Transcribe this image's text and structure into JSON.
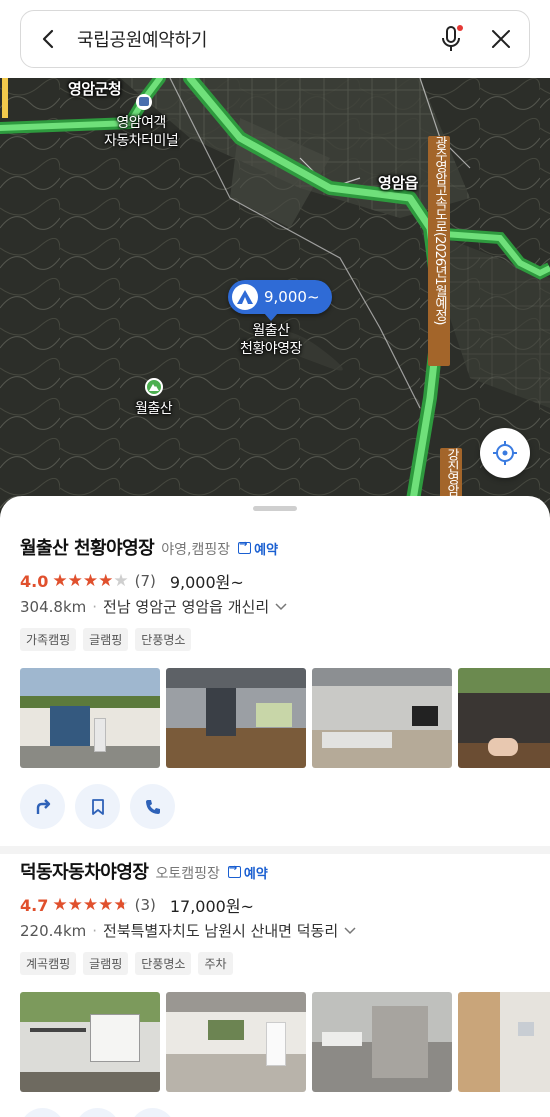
{
  "search": {
    "query": "국립공원예약하기"
  },
  "map": {
    "labels": {
      "county_office": "영암군청",
      "terminal": "영암여객\n자동차터미널",
      "town": "영암읍",
      "mountain": "월출산",
      "campsite": "월출산\n천황야영장",
      "highway": "광주영암고속도로(2026년1월예정)",
      "road2": "강진영암"
    },
    "pin_price": "9,000~"
  },
  "results": [
    {
      "name": "월출산 천황야영장",
      "category": "야영,캠핑장",
      "reserve_label": "예약",
      "rating": "4.0",
      "stars_filled": 4,
      "review_count": "(7)",
      "price": "9,000원~",
      "distance": "304.8km",
      "address": "전남 영암군 영암읍 개신리",
      "tags": [
        "가족캠핑",
        "글램핑",
        "단풍명소"
      ]
    },
    {
      "name": "덕동자동차야영장",
      "category": "오토캠핑장",
      "reserve_label": "예약",
      "rating": "4.7",
      "stars_filled": 4.5,
      "review_count": "(3)",
      "price": "17,000원~",
      "distance": "220.4km",
      "address": "전북특별자치도 남원시 산내면 덕동리",
      "tags": [
        "계곡캠핑",
        "글램핑",
        "단풍명소",
        "주차"
      ]
    }
  ],
  "colors": {
    "accent": "#1a5fd1",
    "rating": "#e0502d",
    "road": "#5bd16a",
    "pin": "#2f6bd6"
  }
}
